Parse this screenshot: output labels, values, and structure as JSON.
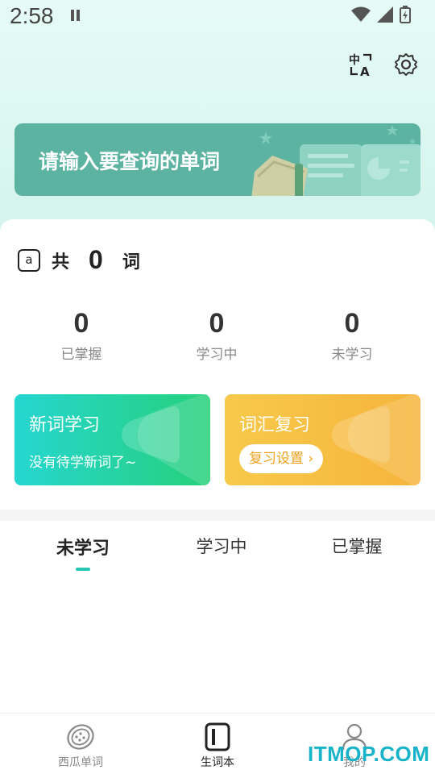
{
  "status_bar": {
    "time": "2:58"
  },
  "search": {
    "placeholder": "请输入要查询的单词"
  },
  "summary": {
    "prefix": "共",
    "count": "0",
    "suffix": "词",
    "icon_letter": "a"
  },
  "stats": [
    {
      "value": "0",
      "label": "已掌握"
    },
    {
      "value": "0",
      "label": "学习中"
    },
    {
      "value": "0",
      "label": "未学习"
    }
  ],
  "actions": {
    "new": {
      "title": "新词学习",
      "subtitle": "没有待学新词了~"
    },
    "review": {
      "title": "词汇复习",
      "button": "复习设置"
    }
  },
  "tabs": [
    {
      "label": "未学习",
      "active": true
    },
    {
      "label": "学习中",
      "active": false
    },
    {
      "label": "已掌握",
      "active": false
    }
  ],
  "bottom_nav": [
    {
      "label": "西瓜单词",
      "icon": "watermelon-icon"
    },
    {
      "label": "生词本",
      "icon": "notebook-icon",
      "active": true
    },
    {
      "label": "我的",
      "icon": "person-icon"
    }
  ],
  "watermark": "ITMOP.COM",
  "colors": {
    "accent": "#26c6b0",
    "banner": "#5db3a2",
    "new_card_start": "#26d6d0",
    "new_card_end": "#26d07a",
    "review_card_start": "#f7c94a",
    "review_card_end": "#f6b43c"
  }
}
